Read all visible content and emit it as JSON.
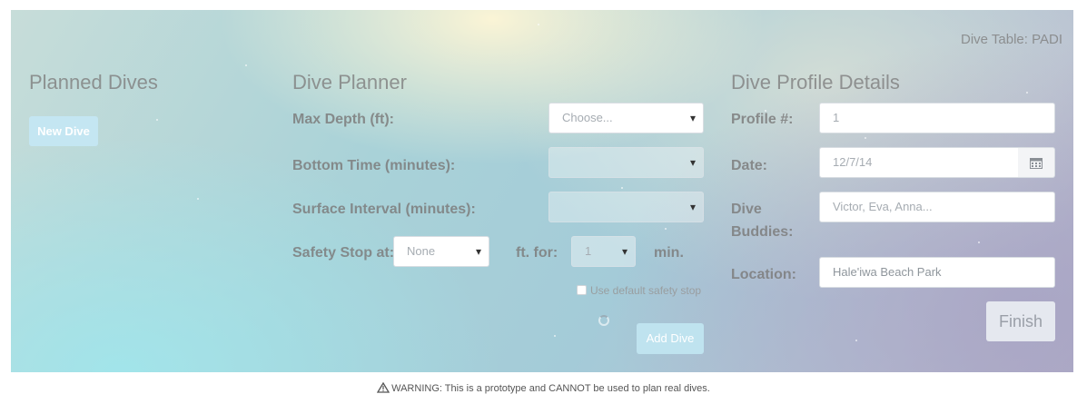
{
  "header": {
    "dive_table": "Dive Table: PADI"
  },
  "planned_dives": {
    "title": "Planned Dives",
    "new_dive_label": "New Dive"
  },
  "planner": {
    "title": "Dive Planner",
    "max_depth_label": "Max Depth (ft):",
    "max_depth_value": "Choose...",
    "bottom_time_label": "Bottom Time (minutes):",
    "bottom_time_value": "",
    "surface_interval_label": "Surface Interval (minutes):",
    "surface_interval_value": "",
    "safety_stop_label": "Safety Stop at:",
    "safety_stop_value": "None",
    "ft_for_label": "ft. for:",
    "minutes_value": "1",
    "min_label": "min.",
    "default_stop_label": "Use default safety stop",
    "add_dive_label": "Add Dive"
  },
  "profile": {
    "title": "Dive Profile Details",
    "profile_label": "Profile #:",
    "profile_value": "1",
    "date_label": "Date:",
    "date_value": "12/7/14",
    "buddies_label_1": "Dive",
    "buddies_label_2": "Buddies:",
    "buddies_placeholder": "Victor, Eva, Anna...",
    "location_label": "Location:",
    "location_value": "Hale'iwa Beach Park",
    "finish_label": "Finish"
  },
  "footer": {
    "warning": "WARNING: This is a prototype and CANNOT be used to plan real dives."
  },
  "icons": {
    "calendar": "calendar-icon",
    "warning": "warning-triangle-icon"
  },
  "colors": {
    "button_blue": "#c4e6f2",
    "finish_button": "#e5e8ef"
  }
}
